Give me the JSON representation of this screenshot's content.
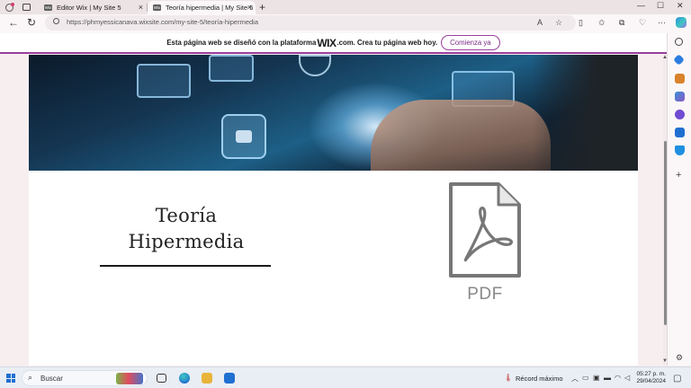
{
  "browser": {
    "tabs": [
      {
        "label": "Editor Wix | My Site 5",
        "favicon": "wix-icon",
        "favicon_text": "Wix",
        "active": false
      },
      {
        "label": "Teoría hipermedia | My Site 5",
        "favicon": "wix-icon",
        "favicon_text": "Wix",
        "active": true
      }
    ],
    "new_tab_symbol": "+",
    "address": {
      "url": "https://phmyessicanava.wixsite.com/my-site-5/teoría-hipermedia"
    },
    "window_controls": {
      "minimize": "—",
      "maximize": "☐",
      "close": "✕"
    }
  },
  "wix_banner": {
    "text_before": "Esta página web se diseñó con la plataforma",
    "brand": "WIX",
    "text_after": ".com. Crea tu página web hoy.",
    "cta_label": "Comienza ya",
    "accent_color": "#9a3e9c"
  },
  "page": {
    "title_line1": "Teoría",
    "title_line2": "Hipermedia",
    "pdf_label": "PDF",
    "hero_image": "technology-hand-screens-image"
  },
  "taskbar": {
    "search_label": "Buscar",
    "weather_text": "Récord máximo",
    "time": "05:27 p. m.",
    "date": "29/04/2024"
  }
}
